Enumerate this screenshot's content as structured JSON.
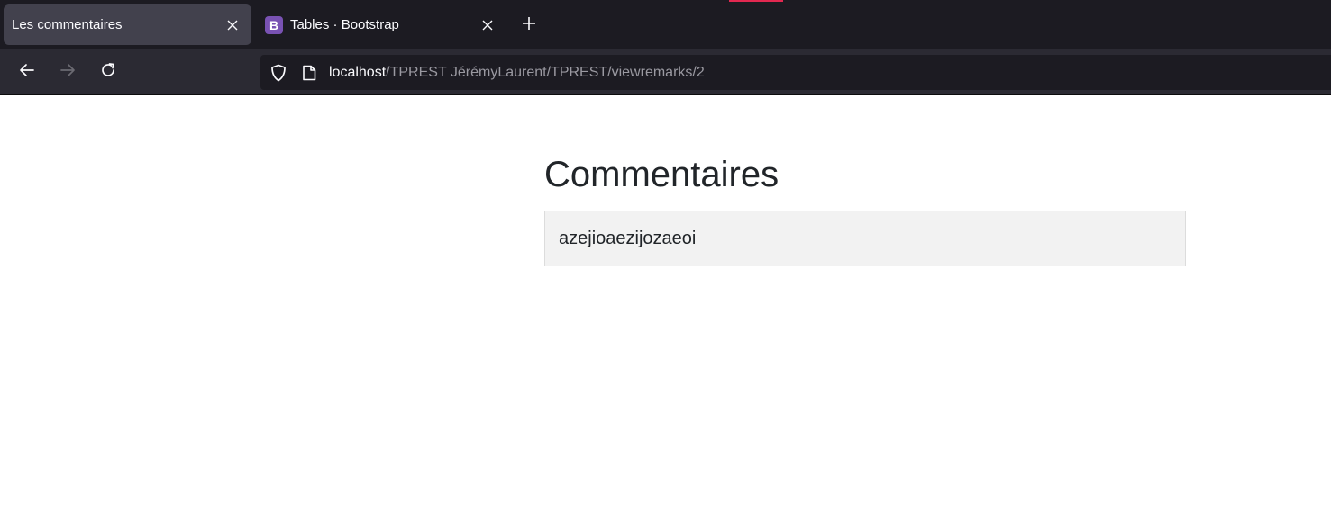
{
  "browser": {
    "tabs": [
      {
        "title": "Les commentaires",
        "active": true
      },
      {
        "title": "Tables · Bootstrap",
        "active": false,
        "favicon_letter": "B",
        "favicon_color": "#7952b3"
      }
    ],
    "url": {
      "host": "localhost",
      "path": "/TPREST JérémyLaurent/TPREST/viewremarks/2"
    },
    "icons": {
      "back": "arrow-left-icon",
      "forward": "arrow-right-icon",
      "reload": "reload-icon",
      "tracking": "shield-icon",
      "page": "page-icon",
      "close": "close-icon",
      "new_tab": "plus-icon"
    },
    "colors": {
      "tabstrip": "#1c1b22",
      "active_tab": "#42414d",
      "navbar": "#2b2a33",
      "accent": "#e22850"
    }
  },
  "page": {
    "heading": "Commentaires",
    "remarks": [
      "azejioaezijozaeoi"
    ]
  }
}
